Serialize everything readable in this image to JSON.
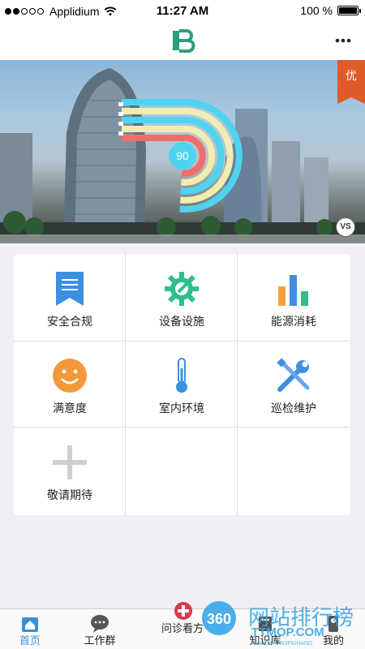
{
  "status_bar": {
    "carrier": "Applidium",
    "time": "11:27 AM",
    "battery": "100 %"
  },
  "header": {
    "logo_icon": "brand-logo-icon",
    "more_icon": "ellipsis-icon"
  },
  "banner": {
    "badge": "优",
    "score": "90",
    "vs_label": "VS",
    "ring_colors": [
      "#4fd3ef",
      "#f1ecb0",
      "#4fd3ef",
      "#f1ecb0",
      "#f36c6c"
    ]
  },
  "grid": {
    "items": [
      {
        "label": "安全合规",
        "icon": "bookmark-document-icon"
      },
      {
        "label": "设备设施",
        "icon": "gear-wrench-icon"
      },
      {
        "label": "能源消耗",
        "icon": "bar-chart-icon"
      },
      {
        "label": "满意度",
        "icon": "smiley-icon"
      },
      {
        "label": "室内环境",
        "icon": "thermometer-icon"
      },
      {
        "label": "巡检维护",
        "icon": "tools-icon"
      },
      {
        "label": "敬请期待",
        "icon": "plus-icon"
      }
    ]
  },
  "tab_bar": {
    "tabs": [
      {
        "label": "首页",
        "icon": "home-icon",
        "active": true
      },
      {
        "label": "工作群",
        "icon": "chat-bubble-icon",
        "active": false
      },
      {
        "label": "问诊看方",
        "icon": "medical-plus-icon",
        "active": false
      },
      {
        "label": "知识库",
        "icon": "book-icon",
        "active": false
      },
      {
        "label": "我的",
        "icon": "person-icon",
        "active": false
      }
    ]
  },
  "watermark": {
    "number": "360",
    "text": "网站排行榜",
    "domain": "TTMOP.COM",
    "sub": "WANGZHAN3PAIHANG"
  },
  "colors": {
    "accent": "#3b8fd6",
    "brand_green": "#2b9e7c",
    "badge_orange": "#e05a2b"
  }
}
